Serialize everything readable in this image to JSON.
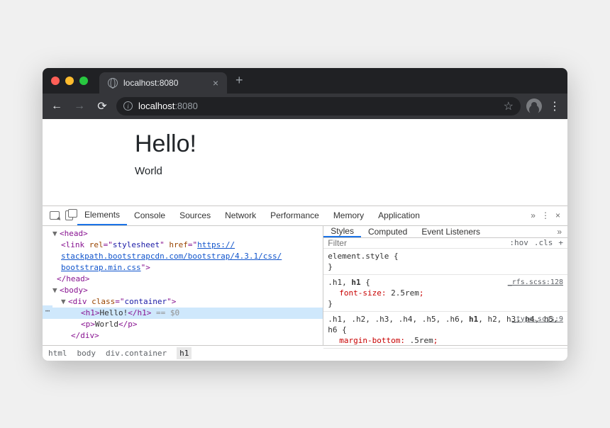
{
  "browser": {
    "tab_title": "localhost:8080",
    "url_host": "localhost",
    "url_port": ":8080"
  },
  "page": {
    "heading": "Hello!",
    "paragraph": "World"
  },
  "devtools": {
    "tabs": [
      "Elements",
      "Console",
      "Sources",
      "Network",
      "Performance",
      "Memory",
      "Application"
    ],
    "active_tab": "Elements",
    "styles_tabs": [
      "Styles",
      "Computed",
      "Event Listeners"
    ],
    "active_styles_tab": "Styles",
    "filter_placeholder": "Filter",
    "hov_label": ":hov",
    "cls_label": ".cls",
    "breadcrumb": [
      "html",
      "body",
      "div.container",
      "h1"
    ],
    "elements": {
      "head_open": "<head>",
      "link_rel": "rel",
      "link_rel_val": "stylesheet",
      "link_href": "href",
      "link_url_1": "https://",
      "link_url_2": "stackpath.bootstrapcdn.com/bootstrap/4.3.1/css/",
      "link_url_3": "bootstrap.min.css",
      "head_close": "</head>",
      "body_open": "<body>",
      "div_open": "<div",
      "div_class_attr": "class",
      "div_class_val": "container",
      "h1_open": "<h1>",
      "h1_text": "Hello!",
      "h1_close": "</h1>",
      "eq0": " == $0",
      "p_open": "<p>",
      "p_text": "World",
      "p_close": "</p>",
      "div_close": "</div>"
    },
    "styles": {
      "element_style": "element.style {",
      "rule1_sel": ".h1, ",
      "rule1_sel_match": "h1",
      "rule1_open": " {",
      "rule1_src": "_rfs.scss:128",
      "rule1_prop": "font-size",
      "rule1_val": "2.5rem",
      "rule2_sel": ".h1, .h2, .h3, .h4, .h5, .h6, ",
      "rule2_sel_match": "h1",
      "rule2_rest": ", h2, h3, h4, h5, h6 {",
      "rule2_src": "_type.scss:9",
      "rule2_prop": "margin-bottom",
      "rule2_val": ".5rem"
    }
  }
}
